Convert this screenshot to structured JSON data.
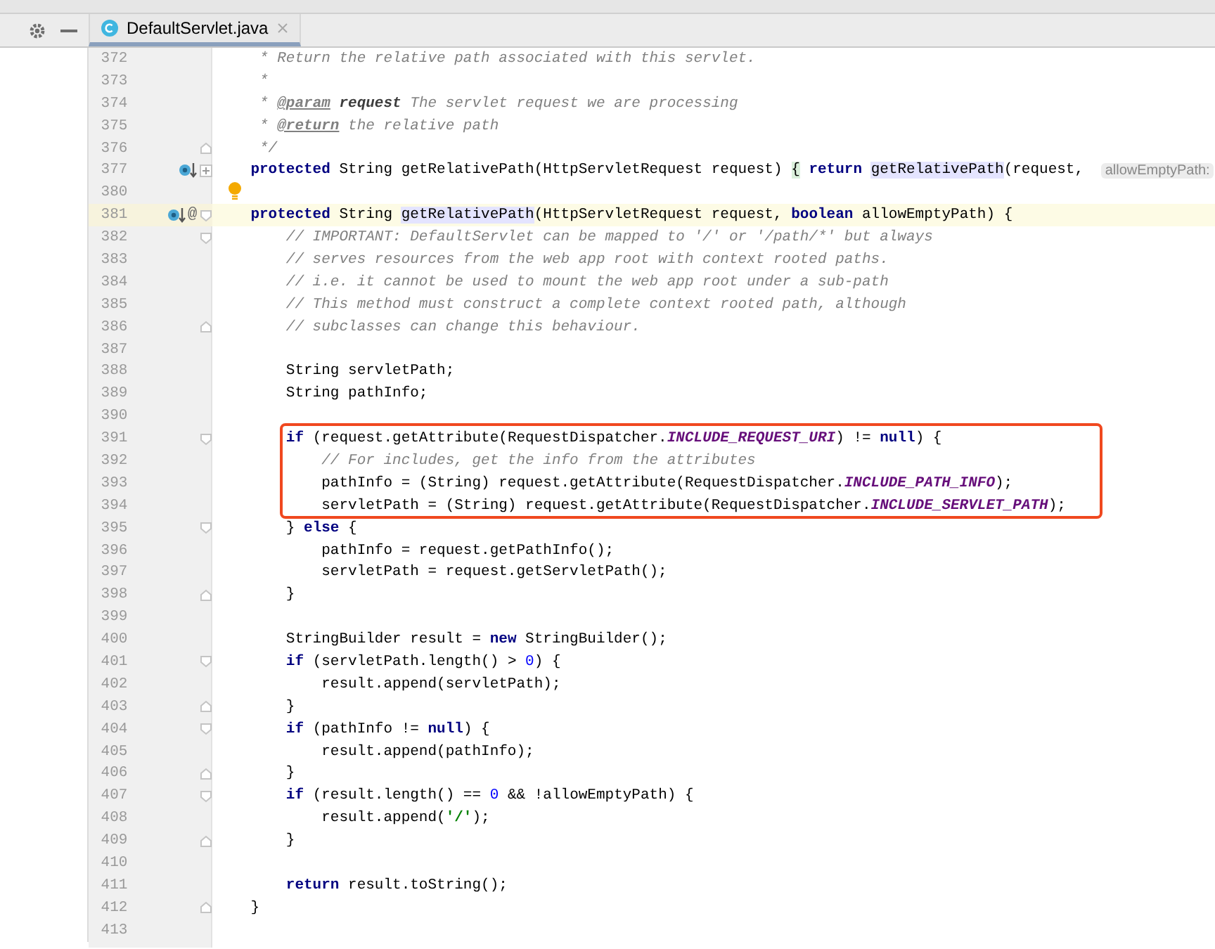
{
  "tab": {
    "title": "DefaultServlet.java",
    "selected": true
  },
  "editor": {
    "lines": [
      {
        "number": "372",
        "tokens": [
          {
            "kind": "comment",
            "text": "     * Return the relative path associated with this servlet."
          }
        ]
      },
      {
        "number": "373",
        "tokens": [
          {
            "kind": "comment",
            "text": "     *"
          }
        ]
      },
      {
        "number": "374",
        "tokens": [
          {
            "kind": "comment",
            "text": "     * "
          },
          {
            "kind": "doctag",
            "text": "@param"
          },
          {
            "kind": "docparam",
            "text": " request"
          },
          {
            "kind": "comment",
            "text": " The servlet request we are processing"
          }
        ]
      },
      {
        "number": "375",
        "tokens": [
          {
            "kind": "comment",
            "text": "     * "
          },
          {
            "kind": "doctag",
            "text": "@return"
          },
          {
            "kind": "comment",
            "text": " the relative path"
          }
        ]
      },
      {
        "number": "376",
        "fold": {
          "kind": "end"
        },
        "tokens": [
          {
            "kind": "comment",
            "text": "     */"
          }
        ]
      },
      {
        "number": "377",
        "fold": {
          "kind": "collapsed"
        },
        "gutter": [
          {
            "kind": "override"
          }
        ],
        "tokens": [
          {
            "kind": "kw",
            "text": "    protected"
          },
          {
            "kind": "plain",
            "text": " String getRelativePath(HttpServletRequest request) "
          },
          {
            "kind": "brace",
            "text": "{"
          },
          {
            "kind": "kw",
            "text": " return "
          },
          {
            "kind": "ident",
            "text": "getRelativePath"
          },
          {
            "kind": "plain",
            "text": "(request, "
          }
        ],
        "hint": "allowEmptyPath:"
      },
      {
        "number": "380",
        "intention": true
      },
      {
        "number": "381",
        "current": true,
        "fold": {
          "kind": "start"
        },
        "gutter": [
          {
            "kind": "override"
          }
        ],
        "gutter_mark": "@",
        "tokens": [
          {
            "kind": "kw",
            "text": "    protected"
          },
          {
            "kind": "plain",
            "text": " String "
          },
          {
            "kind": "ident",
            "text": "getRelativePath"
          },
          {
            "kind": "plain",
            "text": "(HttpServletRequest request, "
          },
          {
            "kind": "kw",
            "text": "boolean"
          },
          {
            "kind": "plain",
            "text": " allowEmptyPath) {"
          }
        ]
      },
      {
        "number": "382",
        "fold": {
          "kind": "start"
        },
        "tokens": [
          {
            "kind": "comment",
            "text": "        // IMPORTANT: DefaultServlet can be mapped to '/' or '/path/*' but always"
          }
        ]
      },
      {
        "number": "383",
        "tokens": [
          {
            "kind": "comment",
            "text": "        // serves resources from the web app root with context rooted paths."
          }
        ]
      },
      {
        "number": "384",
        "tokens": [
          {
            "kind": "comment",
            "text": "        // i.e. it cannot be used to mount the web app root under a sub-path"
          }
        ]
      },
      {
        "number": "385",
        "tokens": [
          {
            "kind": "comment",
            "text": "        // This method must construct a complete context rooted path, although"
          }
        ]
      },
      {
        "number": "386",
        "fold": {
          "kind": "end"
        },
        "tokens": [
          {
            "kind": "comment",
            "text": "        // subclasses can change this behaviour."
          }
        ]
      },
      {
        "number": "387"
      },
      {
        "number": "388",
        "tokens": [
          {
            "kind": "plain",
            "text": "        String servletPath;"
          }
        ]
      },
      {
        "number": "389",
        "tokens": [
          {
            "kind": "plain",
            "text": "        String pathInfo;"
          }
        ]
      },
      {
        "number": "390"
      },
      {
        "number": "391",
        "fold": {
          "kind": "start"
        },
        "boxed": true,
        "tokens": [
          {
            "kind": "kw",
            "text": "        if"
          },
          {
            "kind": "plain",
            "text": " (request.getAttribute(RequestDispatcher."
          },
          {
            "kind": "const",
            "text": "INCLUDE_REQUEST_URI"
          },
          {
            "kind": "plain",
            "text": ") != "
          },
          {
            "kind": "kw",
            "text": "null"
          },
          {
            "kind": "plain",
            "text": ") {"
          }
        ]
      },
      {
        "number": "392",
        "boxed": true,
        "tokens": [
          {
            "kind": "comment",
            "text": "            // For includes, get the info from the attributes"
          }
        ]
      },
      {
        "number": "393",
        "boxed": true,
        "tokens": [
          {
            "kind": "plain",
            "text": "            pathInfo = (String) request.getAttribute(RequestDispatcher."
          },
          {
            "kind": "const",
            "text": "INCLUDE_PATH_INFO"
          },
          {
            "kind": "plain",
            "text": ");"
          }
        ]
      },
      {
        "number": "394",
        "boxed": true,
        "tokens": [
          {
            "kind": "plain",
            "text": "            servletPath = (String) request.getAttribute(RequestDispatcher."
          },
          {
            "kind": "const",
            "text": "INCLUDE_SERVLET_PATH"
          },
          {
            "kind": "plain",
            "text": ");"
          }
        ]
      },
      {
        "number": "395",
        "fold": {
          "kind": "start"
        },
        "tokens": [
          {
            "kind": "plain",
            "text": "        } "
          },
          {
            "kind": "kw",
            "text": "else"
          },
          {
            "kind": "plain",
            "text": " {"
          }
        ]
      },
      {
        "number": "396",
        "tokens": [
          {
            "kind": "plain",
            "text": "            pathInfo = request.getPathInfo();"
          }
        ]
      },
      {
        "number": "397",
        "tokens": [
          {
            "kind": "plain",
            "text": "            servletPath = request.getServletPath();"
          }
        ]
      },
      {
        "number": "398",
        "fold": {
          "kind": "end"
        },
        "tokens": [
          {
            "kind": "plain",
            "text": "        }"
          }
        ]
      },
      {
        "number": "399"
      },
      {
        "number": "400",
        "tokens": [
          {
            "kind": "plain",
            "text": "        StringBuilder result = "
          },
          {
            "kind": "kw",
            "text": "new"
          },
          {
            "kind": "plain",
            "text": " StringBuilder();"
          }
        ]
      },
      {
        "number": "401",
        "fold": {
          "kind": "start"
        },
        "tokens": [
          {
            "kind": "kw",
            "text": "        if"
          },
          {
            "kind": "plain",
            "text": " (servletPath.length() > "
          },
          {
            "kind": "num",
            "text": "0"
          },
          {
            "kind": "plain",
            "text": ") {"
          }
        ]
      },
      {
        "number": "402",
        "tokens": [
          {
            "kind": "plain",
            "text": "            result.append(servletPath);"
          }
        ]
      },
      {
        "number": "403",
        "fold": {
          "kind": "end"
        },
        "tokens": [
          {
            "kind": "plain",
            "text": "        }"
          }
        ]
      },
      {
        "number": "404",
        "fold": {
          "kind": "start"
        },
        "tokens": [
          {
            "kind": "kw",
            "text": "        if"
          },
          {
            "kind": "plain",
            "text": " (pathInfo != "
          },
          {
            "kind": "kw",
            "text": "null"
          },
          {
            "kind": "plain",
            "text": ") {"
          }
        ]
      },
      {
        "number": "405",
        "tokens": [
          {
            "kind": "plain",
            "text": "            result.append(pathInfo);"
          }
        ]
      },
      {
        "number": "406",
        "fold": {
          "kind": "end"
        },
        "tokens": [
          {
            "kind": "plain",
            "text": "        }"
          }
        ]
      },
      {
        "number": "407",
        "fold": {
          "kind": "start"
        },
        "tokens": [
          {
            "kind": "kw",
            "text": "        if"
          },
          {
            "kind": "plain",
            "text": " (result.length() == "
          },
          {
            "kind": "num",
            "text": "0"
          },
          {
            "kind": "plain",
            "text": " && !allowEmptyPath) {"
          }
        ]
      },
      {
        "number": "408",
        "tokens": [
          {
            "kind": "plain",
            "text": "            result.append("
          },
          {
            "kind": "str",
            "text": "'/'"
          },
          {
            "kind": "plain",
            "text": ");"
          }
        ]
      },
      {
        "number": "409",
        "fold": {
          "kind": "end"
        },
        "tokens": [
          {
            "kind": "plain",
            "text": "        }"
          }
        ]
      },
      {
        "number": "410"
      },
      {
        "number": "411",
        "tokens": [
          {
            "kind": "kw",
            "text": "        return"
          },
          {
            "kind": "plain",
            "text": " result.toString();"
          }
        ]
      },
      {
        "number": "412",
        "fold": {
          "kind": "end"
        },
        "tokens": [
          {
            "kind": "plain",
            "text": "    }"
          }
        ]
      },
      {
        "number": "413"
      }
    ]
  }
}
